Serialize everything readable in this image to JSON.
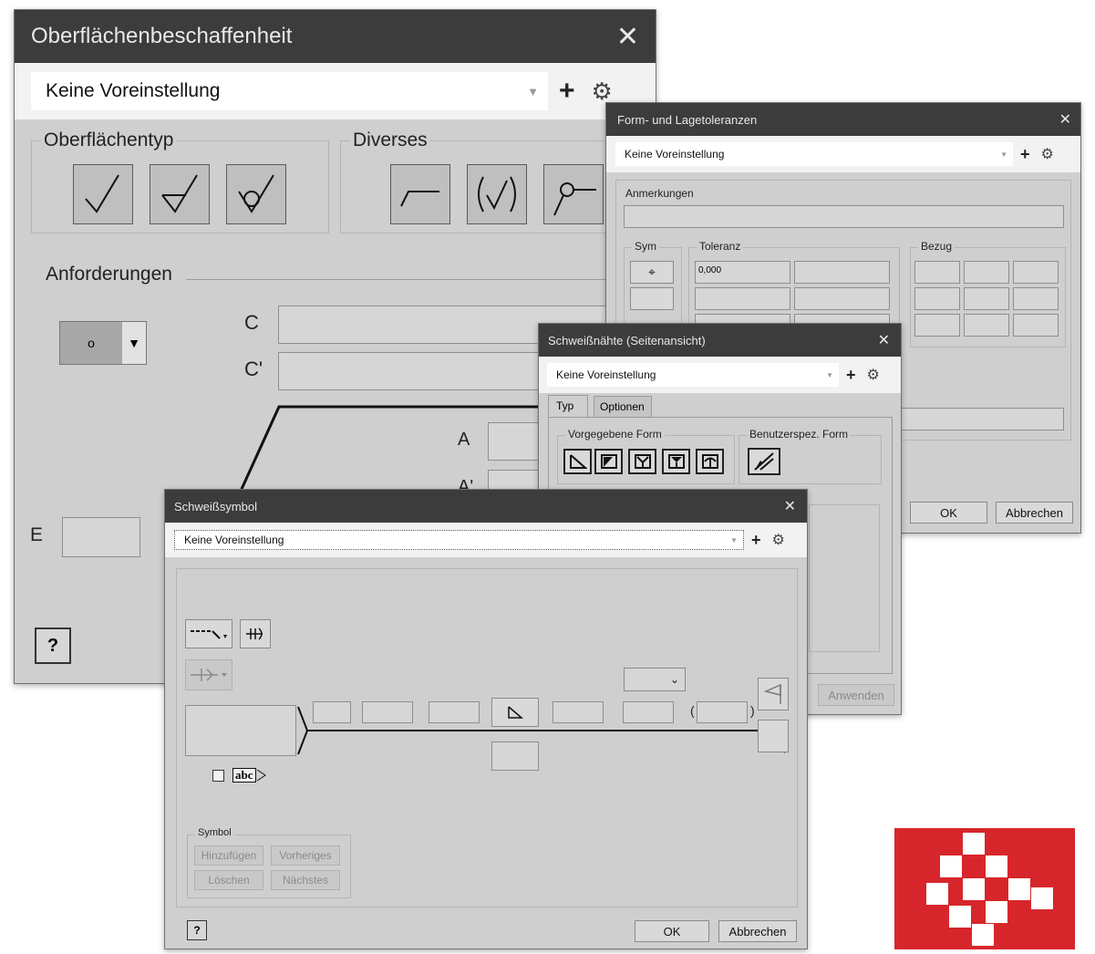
{
  "surface": {
    "title": "Oberflächenbeschaffenheit",
    "preset": "Keine Voreinstellung",
    "group_type": "Oberflächentyp",
    "group_misc": "Diverses",
    "requirements": "Anforderungen",
    "label_c": "C",
    "label_c2": "C'",
    "label_a": "A",
    "label_a2": "A'",
    "label_e": "E",
    "help_glyph": "?"
  },
  "tolerance": {
    "title": "Form- und Lagetoleranzen",
    "preset": "Keine Voreinstellung",
    "notes_label": "Anmerkungen",
    "sym_label": "Sym",
    "tol_label": "Toleranz",
    "ref_label": "Bezug",
    "tol_value": "0,000",
    "ok": "OK",
    "cancel": "Abbrechen"
  },
  "weld_side": {
    "title": "Schweißnähte (Seitenansicht)",
    "preset": "Keine Voreinstellung",
    "tab_type": "Typ",
    "tab_options": "Optionen",
    "group_predef": "Vorgegebene Form",
    "group_custom": "Benutzerspez. Form",
    "apply": "Anwenden"
  },
  "weld_symbol": {
    "title": "Schweißsymbol",
    "preset": "Keine Voreinstellung",
    "abc": "abc",
    "paren_open": "(",
    "paren_close": ")",
    "group_symbol": "Symbol",
    "add": "Hinzufügen",
    "prev": "Vorheriges",
    "delete": "Löschen",
    "next": "Nächstes",
    "help_glyph": "?",
    "ok": "OK",
    "cancel": "Abbrechen"
  },
  "icons": [
    "close-icon",
    "plus-icon",
    "gear-icon",
    "dropdown-caret-icon",
    "surface-basic-icon",
    "surface-removal-icon",
    "surface-no-removal-icon",
    "lay-icon",
    "brackets-icon",
    "all-around-icon",
    "help-icon",
    "datum-position-icon",
    "fillet-weld-icon",
    "field-weld-flag-icon",
    "custom-shape-icon",
    "logo"
  ],
  "colors": {
    "titlebar": "#3c3c3c",
    "dialog": "#cfcfcf",
    "logo_red": "#d7262b"
  }
}
